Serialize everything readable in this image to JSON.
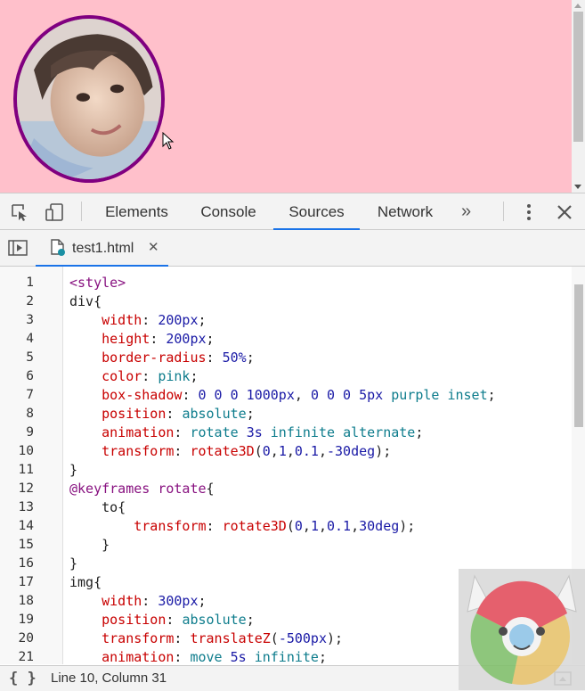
{
  "devtools": {
    "tabs": [
      {
        "label": "Elements",
        "active": false
      },
      {
        "label": "Console",
        "active": false
      },
      {
        "label": "Sources",
        "active": true
      },
      {
        "label": "Network",
        "active": false
      }
    ],
    "more_tabs": "»",
    "close": "✕"
  },
  "sources": {
    "file_tab": {
      "name": "test1.html",
      "close": "✕"
    }
  },
  "code": {
    "line_numbers": [
      "1",
      "2",
      "3",
      "4",
      "5",
      "6",
      "7",
      "8",
      "9",
      "10",
      "11",
      "12",
      "13",
      "14",
      "15",
      "16",
      "17",
      "18",
      "19",
      "20",
      "21"
    ],
    "lines": [
      [
        {
          "t": "<style>",
          "c": "tag"
        }
      ],
      [
        {
          "t": "div{",
          "c": "sel"
        }
      ],
      [
        {
          "t": "    "
        },
        {
          "t": "width",
          "c": "prop"
        },
        {
          "t": ": "
        },
        {
          "t": "200px",
          "c": "val"
        },
        {
          "t": ";"
        }
      ],
      [
        {
          "t": "    "
        },
        {
          "t": "height",
          "c": "prop"
        },
        {
          "t": ": "
        },
        {
          "t": "200px",
          "c": "val"
        },
        {
          "t": ";"
        }
      ],
      [
        {
          "t": "    "
        },
        {
          "t": "border-radius",
          "c": "prop"
        },
        {
          "t": ": "
        },
        {
          "t": "50%",
          "c": "val"
        },
        {
          "t": ";"
        }
      ],
      [
        {
          "t": "    "
        },
        {
          "t": "color",
          "c": "prop"
        },
        {
          "t": ": "
        },
        {
          "t": "pink",
          "c": "kw"
        },
        {
          "t": ";"
        }
      ],
      [
        {
          "t": "    "
        },
        {
          "t": "box-shadow",
          "c": "prop"
        },
        {
          "t": ": "
        },
        {
          "t": "0 0 0 1000px",
          "c": "val"
        },
        {
          "t": ", "
        },
        {
          "t": "0 0 0 5px",
          "c": "val"
        },
        {
          "t": " "
        },
        {
          "t": "purple",
          "c": "kw"
        },
        {
          "t": " "
        },
        {
          "t": "inset",
          "c": "kw"
        },
        {
          "t": ";"
        }
      ],
      [
        {
          "t": "    "
        },
        {
          "t": "position",
          "c": "prop"
        },
        {
          "t": ": "
        },
        {
          "t": "absolute",
          "c": "kw"
        },
        {
          "t": ";"
        }
      ],
      [
        {
          "t": "    "
        },
        {
          "t": "animation",
          "c": "prop"
        },
        {
          "t": ": "
        },
        {
          "t": "rotate",
          "c": "kw"
        },
        {
          "t": " "
        },
        {
          "t": "3s",
          "c": "val"
        },
        {
          "t": " "
        },
        {
          "t": "infinite",
          "c": "kw"
        },
        {
          "t": " "
        },
        {
          "t": "alternate",
          "c": "kw"
        },
        {
          "t": ";"
        }
      ],
      [
        {
          "t": "    "
        },
        {
          "t": "transform",
          "c": "prop"
        },
        {
          "t": ": "
        },
        {
          "t": "rotate3D",
          "c": "fn"
        },
        {
          "t": "("
        },
        {
          "t": "0",
          "c": "val"
        },
        {
          "t": ","
        },
        {
          "t": "1",
          "c": "val"
        },
        {
          "t": ","
        },
        {
          "t": "0.1",
          "c": "val"
        },
        {
          "t": ","
        },
        {
          "t": "-30deg",
          "c": "val"
        },
        {
          "t": ");"
        }
      ],
      [
        {
          "t": "}"
        }
      ],
      [
        {
          "t": "@keyframes",
          "c": "at"
        },
        {
          "t": " "
        },
        {
          "t": "rotate",
          "c": "at"
        },
        {
          "t": "{"
        }
      ],
      [
        {
          "t": "    to{"
        }
      ],
      [
        {
          "t": "        "
        },
        {
          "t": "transform",
          "c": "prop"
        },
        {
          "t": ": "
        },
        {
          "t": "rotate3D",
          "c": "fn"
        },
        {
          "t": "("
        },
        {
          "t": "0",
          "c": "val"
        },
        {
          "t": ","
        },
        {
          "t": "1",
          "c": "val"
        },
        {
          "t": ","
        },
        {
          "t": "0.1",
          "c": "val"
        },
        {
          "t": ","
        },
        {
          "t": "30deg",
          "c": "val"
        },
        {
          "t": ");"
        }
      ],
      [
        {
          "t": "    }"
        }
      ],
      [
        {
          "t": "}"
        }
      ],
      [
        {
          "t": "img{",
          "c": "sel"
        }
      ],
      [
        {
          "t": "    "
        },
        {
          "t": "width",
          "c": "prop"
        },
        {
          "t": ": "
        },
        {
          "t": "300px",
          "c": "val"
        },
        {
          "t": ";"
        }
      ],
      [
        {
          "t": "    "
        },
        {
          "t": "position",
          "c": "prop"
        },
        {
          "t": ": "
        },
        {
          "t": "absolute",
          "c": "kw"
        },
        {
          "t": ";"
        }
      ],
      [
        {
          "t": "    "
        },
        {
          "t": "transform",
          "c": "prop"
        },
        {
          "t": ": "
        },
        {
          "t": "translateZ",
          "c": "fn"
        },
        {
          "t": "("
        },
        {
          "t": "-500px",
          "c": "val"
        },
        {
          "t": ");"
        }
      ],
      [
        {
          "t": "    "
        },
        {
          "t": "animation",
          "c": "prop"
        },
        {
          "t": ": "
        },
        {
          "t": "move",
          "c": "kw"
        },
        {
          "t": " "
        },
        {
          "t": "5s",
          "c": "val"
        },
        {
          "t": " "
        },
        {
          "t": "infinite",
          "c": "kw"
        },
        {
          "t": ";"
        }
      ]
    ]
  },
  "status": {
    "braces": "{ }",
    "cursor_position": "Line 10, Column 31"
  },
  "colors": {
    "page_background": "#ffc0cb",
    "ring": "#800080",
    "active_tab_underline": "#1a73e8"
  },
  "icons": [
    "inspect-element-icon",
    "device-toolbar-icon",
    "more-vert-icon",
    "close-icon",
    "navigator-toggle-icon",
    "file-icon",
    "mouse-cursor-icon",
    "drawer-toggle-icon"
  ]
}
